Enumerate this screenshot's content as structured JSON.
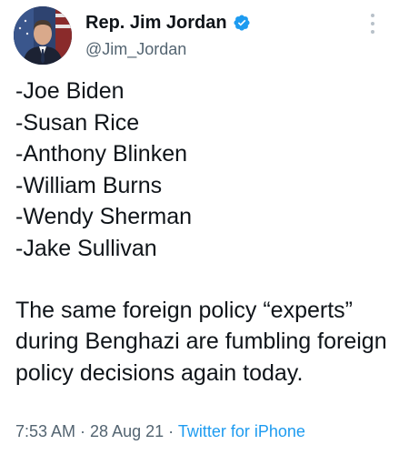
{
  "author": {
    "display_name": "Rep. Jim Jordan",
    "handle": "@Jim_Jordan"
  },
  "tweet": {
    "list": [
      "-Joe Biden",
      "-Susan Rice",
      "-Anthony Blinken",
      "-William Burns",
      "-Wendy Sherman",
      "-Jake Sullivan"
    ],
    "paragraph": "The same foreign policy “experts” during Benghazi are fumbling foreign policy decisions again today."
  },
  "meta": {
    "time": "7:53 AM",
    "separator1": " · ",
    "date": "28 Aug 21",
    "separator2": " · ",
    "source": "Twitter for iPhone"
  },
  "icons": {
    "verified": "verified-badge-icon",
    "more": "more-options-icon"
  },
  "colors": {
    "verified_blue": "#1d9bf0",
    "link_blue": "#1d9bf0",
    "secondary_text": "#536471"
  }
}
